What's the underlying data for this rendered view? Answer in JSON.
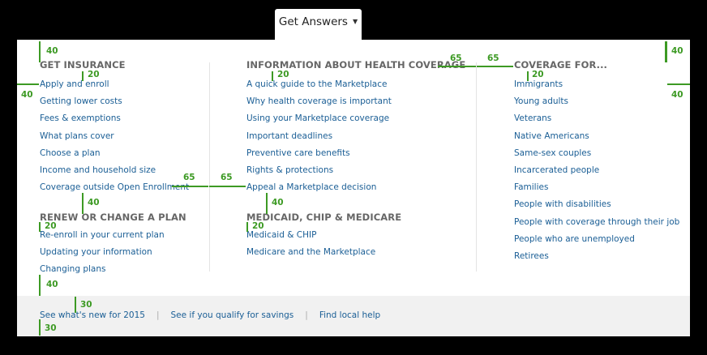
{
  "tab": {
    "label": "Get Answers"
  },
  "columns": [
    {
      "sections": [
        {
          "heading": "GET INSURANCE",
          "links": [
            "Apply and enroll",
            "Getting lower costs",
            "Fees & exemptions",
            "What plans cover",
            "Choose a plan",
            "Income and household size",
            "Coverage outside Open Enrollment"
          ]
        },
        {
          "heading": "RENEW OR CHANGE A PLAN",
          "links": [
            "Re-enroll in your current plan",
            "Updating your information",
            "Changing plans"
          ]
        }
      ]
    },
    {
      "sections": [
        {
          "heading": "INFORMATION ABOUT HEALTH COVERAGE",
          "links": [
            "A quick guide to the Marketplace",
            "Why health coverage is important",
            "Using your Marketplace coverage",
            "Important deadlines",
            "Preventive care benefits",
            "Rights & protections",
            "Appeal a Marketplace decision"
          ]
        },
        {
          "heading": "MEDICAID, CHIP & MEDICARE",
          "links": [
            "Medicaid & CHIP",
            "Medicare and the Marketplace"
          ]
        }
      ]
    },
    {
      "sections": [
        {
          "heading": "COVERAGE FOR...",
          "links": [
            "Immigrants",
            "Young adults",
            "Veterans",
            "Native Americans",
            "Same-sex couples",
            "Incarcerated people",
            "Families",
            "People with disabilities",
            "People with coverage through their job",
            "People who are unemployed",
            "Retirees"
          ]
        }
      ]
    }
  ],
  "footer": {
    "links": [
      "See what's new for 2015",
      "See if you qualify for savings",
      "Find local help"
    ]
  },
  "annotations": [
    "40",
    "20",
    "40",
    "40",
    "40",
    "65",
    "65",
    "20",
    "20",
    "65",
    "65",
    "40",
    "20",
    "40",
    "20",
    "40",
    "30",
    "30"
  ],
  "colors": {
    "annotation": "#3d9a24",
    "link": "#1a5e95",
    "heading": "#666666",
    "footer_bg": "#f1f1f1"
  }
}
